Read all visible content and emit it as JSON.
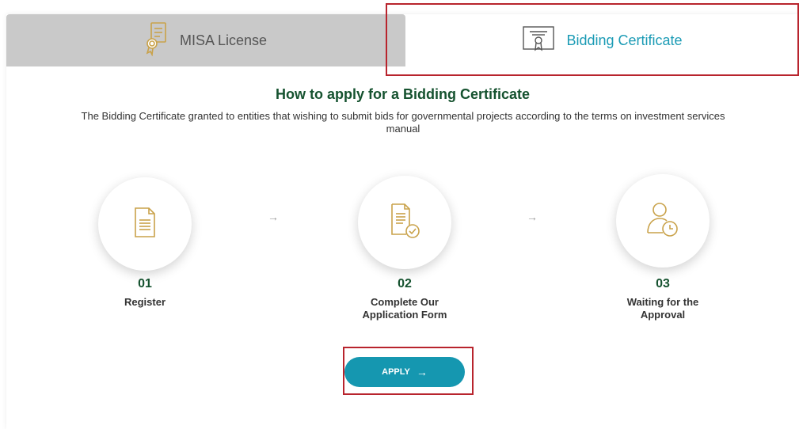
{
  "tabs": {
    "misa": {
      "label": "MISA License",
      "icon": "license-badge-icon"
    },
    "bidding": {
      "label": "Bidding Certificate",
      "icon": "certificate-icon",
      "active": true
    }
  },
  "main": {
    "heading": "How to apply for a Bidding Certificate",
    "description": "The Bidding Certificate granted to entities that wishing to submit bids for governmental projects according to the terms on investment services manual"
  },
  "steps": [
    {
      "number": "01",
      "label": "Register",
      "icon": "document-icon"
    },
    {
      "number": "02",
      "label": "Complete Our Application Form",
      "icon": "document-check-icon"
    },
    {
      "number": "03",
      "label": "Waiting for the Approval",
      "icon": "user-clock-icon"
    }
  ],
  "step_arrow": "→",
  "apply": {
    "label": "APPLY",
    "arrow": "→"
  },
  "colors": {
    "accent": "#1597b0",
    "heading": "#15522f",
    "icon_gold": "#c9a24a",
    "inactive_tab": "#c9c9c9",
    "highlight": "#b8242d"
  }
}
